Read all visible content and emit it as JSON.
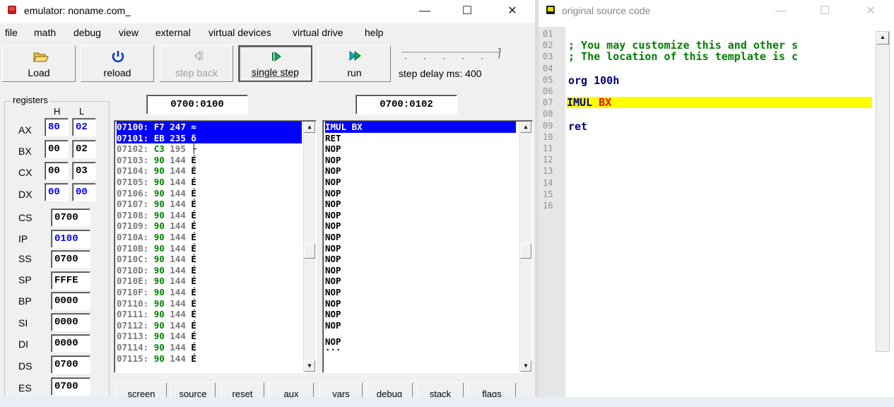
{
  "emulator": {
    "title": "emulator: noname.com_",
    "menu": [
      "file",
      "math",
      "debug",
      "view",
      "external",
      "virtual devices",
      "virtual drive",
      "help"
    ],
    "toolbar": {
      "load": "Load",
      "reload": "reload",
      "step_back": "step back",
      "single_step": "single step",
      "run": "run",
      "step_delay": "step delay ms: 400"
    },
    "registers_label": "registers",
    "col_h": "H",
    "col_l": "L",
    "regs8": [
      {
        "name": "AX",
        "h": "80",
        "l": "02"
      },
      {
        "name": "BX",
        "h": "00",
        "l": "02"
      },
      {
        "name": "CX",
        "h": "00",
        "l": "03"
      },
      {
        "name": "DX",
        "h": "00",
        "l": "00"
      }
    ],
    "regs16": [
      {
        "name": "CS",
        "val": "0700"
      },
      {
        "name": "IP",
        "val": "0100"
      },
      {
        "name": "SS",
        "val": "0700"
      },
      {
        "name": "SP",
        "val": "FFFE"
      },
      {
        "name": "BP",
        "val": "0000"
      },
      {
        "name": "SI",
        "val": "0000"
      },
      {
        "name": "DI",
        "val": "0000"
      },
      {
        "name": "DS",
        "val": "0700"
      },
      {
        "name": "ES",
        "val": "0700"
      }
    ],
    "addr_left": "0700:0100",
    "addr_right": "0700:0102",
    "memory": [
      {
        "addr": "07100:",
        "hex": "F7",
        "dec": "247",
        "ch": "≈"
      },
      {
        "addr": "07101:",
        "hex": "EB",
        "dec": "235",
        "ch": "δ"
      },
      {
        "addr": "07102:",
        "hex": "C3",
        "dec": "195",
        "ch": "├"
      },
      {
        "addr": "07103:",
        "hex": "90",
        "dec": "144",
        "ch": "É"
      },
      {
        "addr": "07104:",
        "hex": "90",
        "dec": "144",
        "ch": "É"
      },
      {
        "addr": "07105:",
        "hex": "90",
        "dec": "144",
        "ch": "É"
      },
      {
        "addr": "07106:",
        "hex": "90",
        "dec": "144",
        "ch": "É"
      },
      {
        "addr": "07107:",
        "hex": "90",
        "dec": "144",
        "ch": "É"
      },
      {
        "addr": "07108:",
        "hex": "90",
        "dec": "144",
        "ch": "É"
      },
      {
        "addr": "07109:",
        "hex": "90",
        "dec": "144",
        "ch": "É"
      },
      {
        "addr": "0710A:",
        "hex": "90",
        "dec": "144",
        "ch": "É"
      },
      {
        "addr": "0710B:",
        "hex": "90",
        "dec": "144",
        "ch": "É"
      },
      {
        "addr": "0710C:",
        "hex": "90",
        "dec": "144",
        "ch": "É"
      },
      {
        "addr": "0710D:",
        "hex": "90",
        "dec": "144",
        "ch": "É"
      },
      {
        "addr": "0710E:",
        "hex": "90",
        "dec": "144",
        "ch": "É"
      },
      {
        "addr": "0710F:",
        "hex": "90",
        "dec": "144",
        "ch": "É"
      },
      {
        "addr": "07110:",
        "hex": "90",
        "dec": "144",
        "ch": "É"
      },
      {
        "addr": "07111:",
        "hex": "90",
        "dec": "144",
        "ch": "É"
      },
      {
        "addr": "07112:",
        "hex": "90",
        "dec": "144",
        "ch": "É"
      },
      {
        "addr": "07113:",
        "hex": "90",
        "dec": "144",
        "ch": "É"
      },
      {
        "addr": "07114:",
        "hex": "90",
        "dec": "144",
        "ch": "É"
      },
      {
        "addr": "07115:",
        "hex": "90",
        "dec": "144",
        "ch": "É"
      }
    ],
    "disasm": [
      "IMUL BX",
      "RET",
      "NOP",
      "NOP",
      "NOP",
      "NOP",
      "NOP",
      "NOP",
      "NOP",
      "NOP",
      "NOP",
      "NOP",
      "NOP",
      "NOP",
      "NOP",
      "NOP",
      "NOP",
      "NOP",
      "NOP",
      "NOP",
      "..."
    ],
    "tabs": [
      "screen",
      "source",
      "reset",
      "aux",
      "vars",
      "debug",
      "stack",
      "flags"
    ]
  },
  "source": {
    "title": "original source code",
    "line_numbers": [
      "01",
      "02",
      "03",
      "04",
      "05",
      "06",
      "07",
      "08",
      "09",
      "10",
      "11",
      "12",
      "13",
      "14",
      "15",
      "16"
    ],
    "lines": {
      "l02": "; You may customize this and other s",
      "l03": "; The location of this template is c",
      "l05": "org 100h",
      "l07_op": "IMUL",
      "l07_arg": "BX",
      "l09": "ret"
    }
  },
  "colors": {
    "selection": "#0000ff",
    "highlight_line": "#ffff00",
    "comment": "#008000",
    "keyword": "#000080",
    "register": "#ff0000",
    "register_changed": "#0000ff"
  }
}
